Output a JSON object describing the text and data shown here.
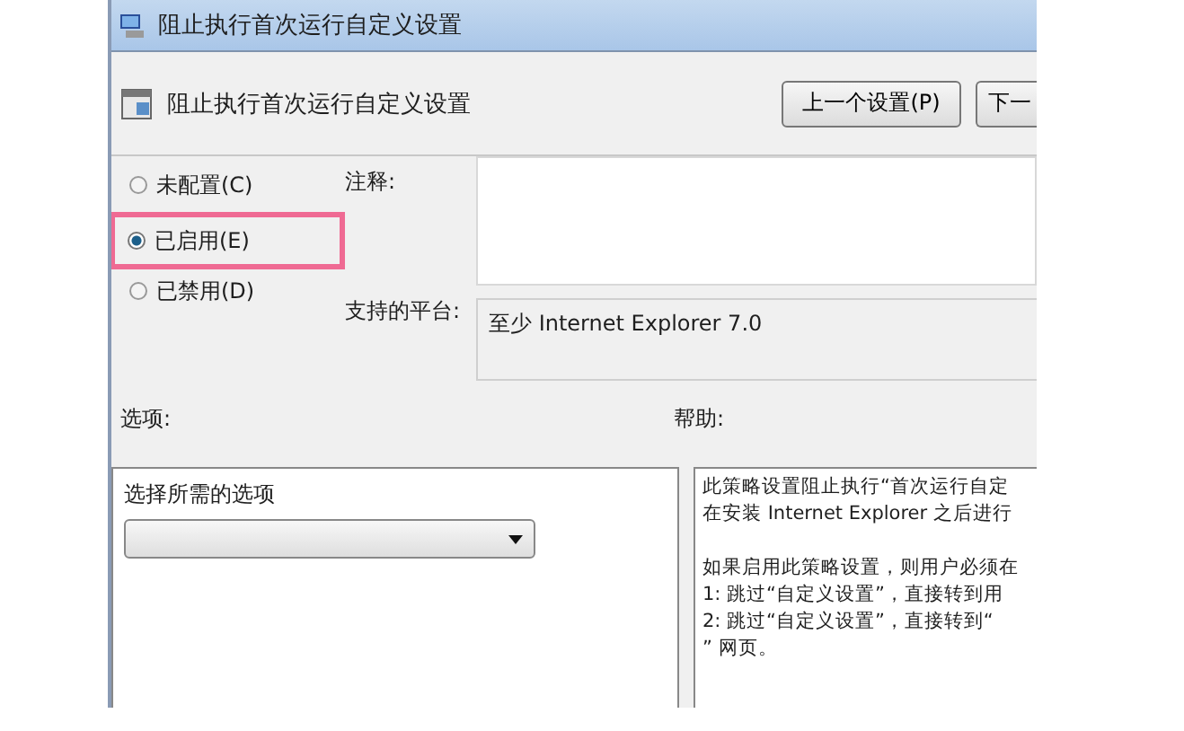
{
  "window": {
    "title": "阻止执行首次运行自定义设置"
  },
  "header": {
    "title": "阻止执行首次运行自定义设置",
    "buttons": [
      "上一个设置(P)",
      "下一"
    ]
  },
  "state_options": [
    {
      "label": "未配置(C)",
      "selected": false,
      "highlighted": false
    },
    {
      "label": "已启用(E)",
      "selected": true,
      "highlighted": true
    },
    {
      "label": "已禁用(D)",
      "selected": false,
      "highlighted": false
    }
  ],
  "comment": {
    "label": "注释:"
  },
  "platform": {
    "label": "支持的平台:",
    "value": "至少 Internet Explorer 7.0"
  },
  "options": {
    "label": "选项:",
    "prompt": "选择所需的选项"
  },
  "help": {
    "label": "帮助:",
    "paragraphs": [
      [
        "此策略设置阻止执行“首次运行自定",
        "在安装 Internet Explorer 之后进行"
      ],
      [
        "如果启用此策略设置，则用户必须在",
        "1: 跳过“自定义设置”，直接转到用",
        "2: 跳过“自定义设置”，直接转到“",
        "” 网页。"
      ]
    ]
  }
}
